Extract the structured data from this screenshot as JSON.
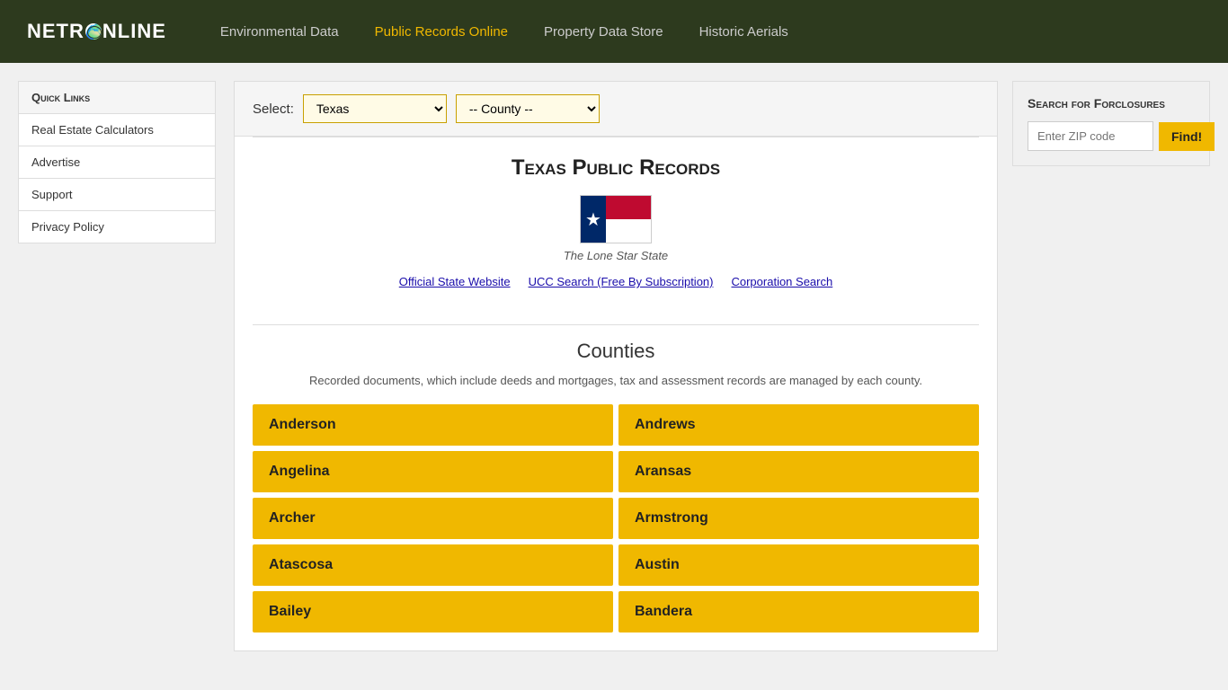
{
  "header": {
    "logo": "NETR NLINE",
    "nav": [
      {
        "label": "Environmental Data",
        "active": false
      },
      {
        "label": "Public Records Online",
        "active": true
      },
      {
        "label": "Property Data Store",
        "active": false
      },
      {
        "label": "Historic Aerials",
        "active": false
      }
    ]
  },
  "sidebar": {
    "title": "Quick Links",
    "items": [
      {
        "label": "Real Estate Calculators"
      },
      {
        "label": "Advertise"
      },
      {
        "label": "Support"
      },
      {
        "label": "Privacy Policy"
      }
    ]
  },
  "select_bar": {
    "label": "Select:",
    "state_value": "Texas",
    "county_placeholder": "-- County --",
    "state_options": [
      "Texas"
    ],
    "county_options": [
      "-- County --"
    ]
  },
  "page": {
    "title": "Texas Public Records",
    "flag_caption": "The Lone Star State",
    "links": [
      {
        "label": "Official State Website"
      },
      {
        "label": "UCC Search (Free By Subscription)"
      },
      {
        "label": "Corporation Search"
      }
    ],
    "counties_title": "Counties",
    "counties_desc": "Recorded documents, which include deeds and mortgages, tax and assessment records are\nmanaged by each county.",
    "counties": [
      "Anderson",
      "Andrews",
      "Angelina",
      "Aransas",
      "Archer",
      "Armstrong",
      "Atascosa",
      "Austin",
      "Bailey",
      "Bandera"
    ]
  },
  "right_panel": {
    "foreclosure_title": "Search for Forclosures",
    "zip_placeholder": "Enter ZIP code",
    "find_label": "Find!"
  }
}
